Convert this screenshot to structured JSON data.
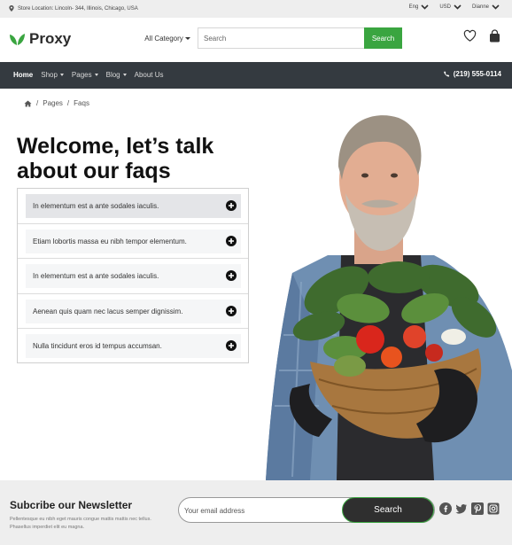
{
  "topbar": {
    "location": "Store Location: Lincoln- 344, Illinois, Chicago, USA",
    "language": "Eng",
    "currency": "USD",
    "user": "Dianne"
  },
  "header": {
    "brand": "Proxy",
    "category": "All Category",
    "search_placeholder": "Search",
    "search_button": "Search"
  },
  "nav": {
    "items": [
      {
        "label": "Home",
        "active": true
      },
      {
        "label": "Shop"
      },
      {
        "label": "Pages"
      },
      {
        "label": "Blog"
      },
      {
        "label": "About Us"
      }
    ],
    "phone": "(219) 555-0114"
  },
  "breadcrumb": {
    "items": [
      "Pages",
      "Faqs"
    ]
  },
  "hero": {
    "title_line1": "Welcome, let’s talk",
    "title_line2": "about our faqs"
  },
  "faqs": [
    "In elementum est a ante sodales iaculis.",
    "Etiam lobortis massa eu nibh tempor elementum.",
    "In elementum est a ante sodales iaculis.",
    "Aenean quis quam nec lacus semper dignissim.",
    "Nulla tincidunt eros id tempus accumsan."
  ],
  "newsletter": {
    "title": "Subcribe our Newsletter",
    "description": "Pellentesque eu nibh eget mauris congue mattis mattis nec tellus. Phasellus imperdiet elit eu magna.",
    "email_placeholder": "Your email address",
    "button": "Search"
  },
  "social": [
    "facebook-icon",
    "twitter-icon",
    "pinterest-icon",
    "instagram-icon"
  ],
  "colors": {
    "accent": "#3aa540",
    "nav_bg": "#343a40",
    "dark_button": "#2f2f2f"
  }
}
